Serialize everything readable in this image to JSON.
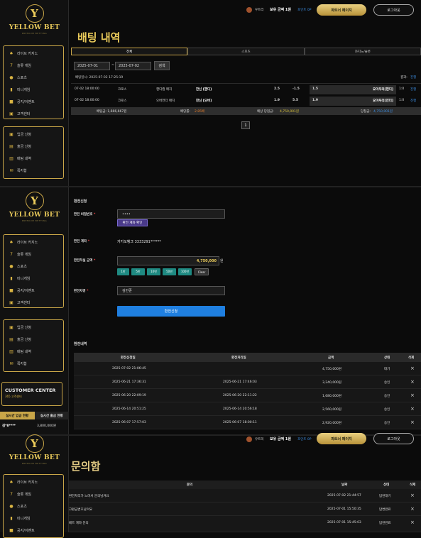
{
  "brand": {
    "name": "YELLOW BET",
    "tagline": "PREMIUM BETTING"
  },
  "header": {
    "user": "우트리",
    "balance_label": "보유 금액 1원",
    "points": "포인트 0P",
    "deposit_btn": "파트너 페이지",
    "logout_btn": "로그아웃"
  },
  "menu_top": [
    "라이브 카지노",
    "슬롯 게임",
    "스포츠",
    "미니게임",
    "공지/이벤트",
    "고객센터"
  ],
  "menu_bottom": [
    "입금 신청",
    "출금 신청",
    "배팅 내역",
    "쪽지함"
  ],
  "betting": {
    "title": "배팅 내역",
    "tabs": [
      "전체",
      "스포츠",
      "카지노/슬롯"
    ],
    "date_from": "2025-07-01",
    "date_sep": "~",
    "date_to": "2025-07-02",
    "search_btn": "검색",
    "bet_time": "배팅일시: 2025-07-02 17:25:19",
    "result_label": "결과:",
    "result_value": "진행",
    "rows": [
      {
        "time": "07-02 18:00:00",
        "league": "크로스",
        "type": "핸디캡 매치",
        "pick": "한신 [핸디]",
        "o1": "2.5",
        "o2": "-1.5",
        "o3": "1.5",
        "team": "요미우리[핸디]",
        "score": "1:0",
        "status": "진행"
      },
      {
        "time": "07-02 18:00:00",
        "league": "크로스",
        "type": "오버언더 매치",
        "pick": "한신 [오버]",
        "o1": "1.9",
        "o2": "5.5",
        "o3": "1.9",
        "team": "요미우리[언더]",
        "score": "1:0",
        "status": "진행"
      }
    ],
    "summary": {
      "bet_amount": "배팅금: 1,666,667원",
      "odds_label": "배당률:",
      "odds_value": "2.85배",
      "exp_label": "예상 당첨금:",
      "exp_value": "4,750,001원",
      "win_label": "당첨금:",
      "win_value": "4,750,001원"
    },
    "page": "1"
  },
  "withdraw": {
    "section_title": "환전신청",
    "pw_label": "환전 비밀번호",
    "pw_value": "••••",
    "acct_btn": "환전 계좌 확인",
    "acct_label": "환전 계좌",
    "acct_value": "카카오뱅크 3333291******",
    "amount_label": "환전하실 금액",
    "amount_value": "4,750,000",
    "amount_unit": "원",
    "chips": [
      "1만",
      "5만",
      "10만",
      "50만",
      "100만",
      "Clear"
    ],
    "name_label": "환전자명",
    "name_value": "김민준",
    "submit_btn": "환전신청",
    "history_title": "환전내역",
    "history_headers": [
      "환전신청일",
      "환전처리일",
      "금액",
      "상태",
      "삭제"
    ],
    "history": [
      {
        "req": "2025-07-02 21:06:45",
        "done": "",
        "amount": "4,750,000원",
        "status": "대기"
      },
      {
        "req": "2025-06-21 17:36:31",
        "done": "2025-06-21 17:46:03",
        "amount": "3,240,000원",
        "status": "승인"
      },
      {
        "req": "2025-06-20 22:09:19",
        "done": "2025-06-20 22:11:22",
        "amount": "1,680,000원",
        "status": "승인"
      },
      {
        "req": "2025-06-14 20:51:25",
        "done": "2025-06-14 20:56:18",
        "amount": "2,560,000원",
        "status": "승인"
      },
      {
        "req": "2025-06-07 17:57:03",
        "done": "2025-06-07 18:00:11",
        "amount": "2,920,000원",
        "status": "승인"
      }
    ],
    "delete_icon": "×"
  },
  "customer_center": {
    "title": "CUSTOMER CENTER",
    "sub": "365 고객센터"
  },
  "live_status": {
    "deposit_tab": "실시간 입금 현황",
    "withdraw_tab": "실시간 출금 현황",
    "row_name": "김*8****",
    "row_amount": "3,800,000원"
  },
  "inquiry": {
    "title": "문의함",
    "headers": [
      "문의",
      "날짜",
      "상태",
      "삭제"
    ],
    "rows": [
      {
        "subject": "환전처리가 느려서 문의남겨요",
        "date": "2025-07-02 21:44:57",
        "status": "답변대기"
      },
      {
        "subject": "고환금변호남겨요",
        "date": "2025-07-01 15:50:35",
        "status": "답변완료"
      },
      {
        "subject": "베트 계좌 문의",
        "date": "2025-07-01 15:45:03",
        "status": "답변완료"
      }
    ]
  },
  "colors": {
    "gold": "#d9b443",
    "teal": "#1f8a82",
    "blue": "#1f7fe0",
    "red": "#e44"
  }
}
